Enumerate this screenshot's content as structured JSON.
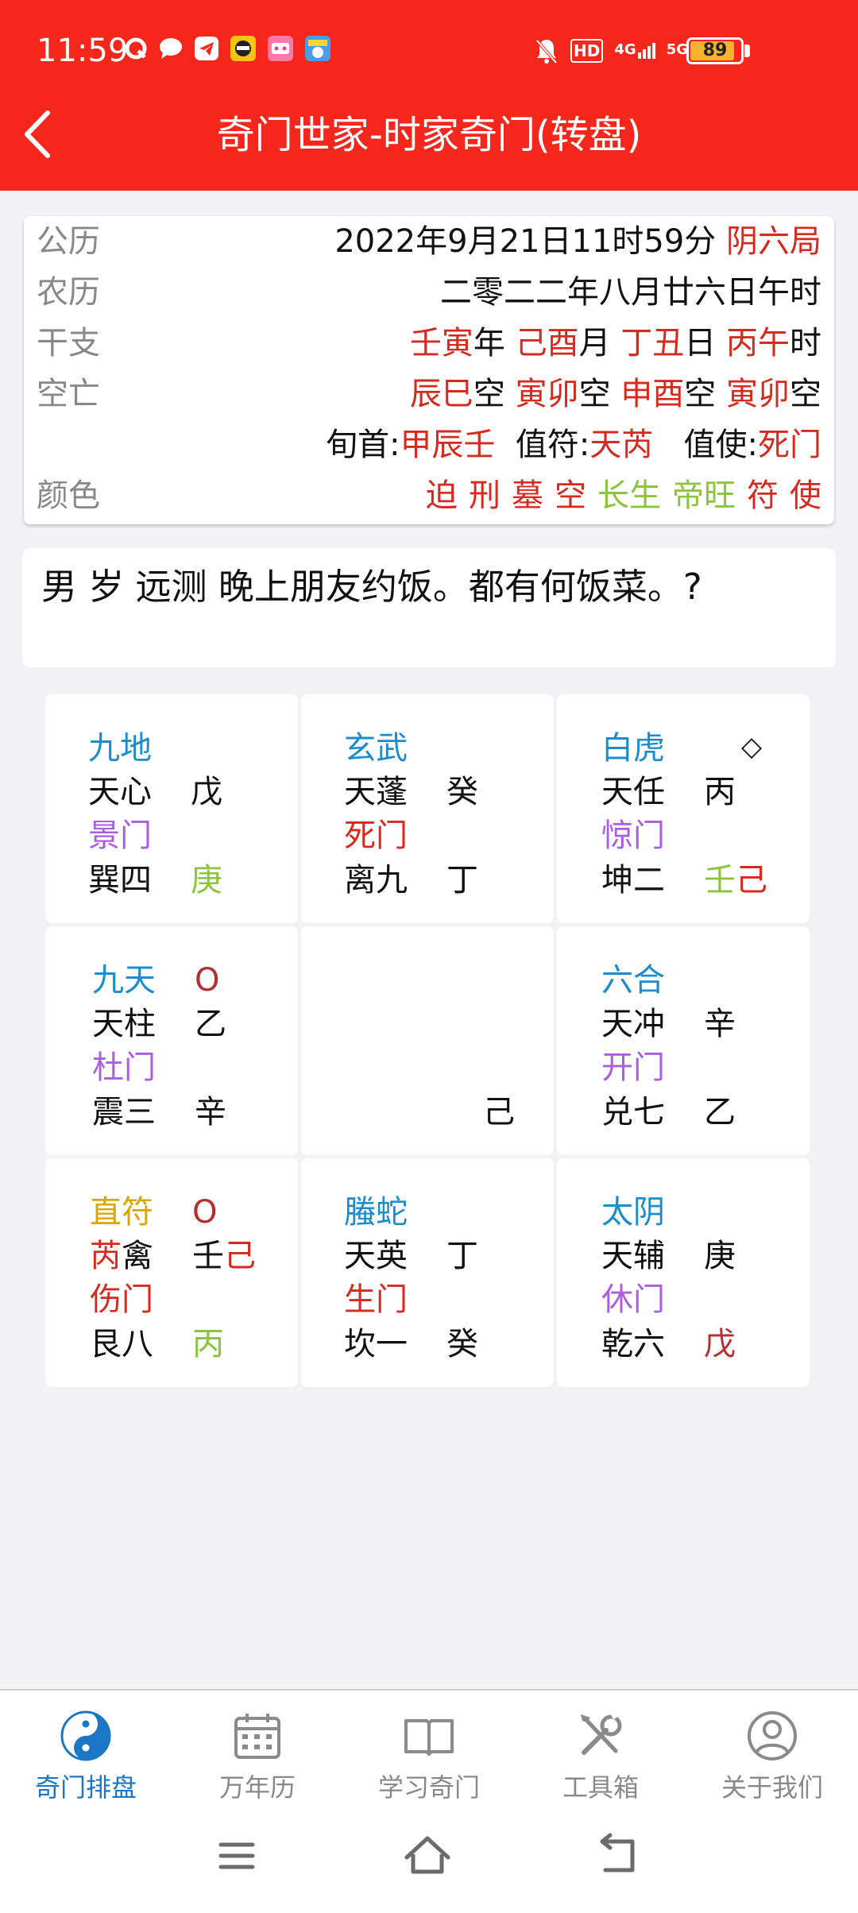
{
  "status_bar": {
    "time": "11:59",
    "notification_icons": [
      "q-icon",
      "chat-bubble-icon",
      "telegram-icon",
      "app-icon-1",
      "app-icon-2",
      "app-icon-3"
    ],
    "signal_labels": [
      "HD",
      "4G",
      "5G"
    ],
    "battery_level": "89",
    "battery_fraction": 0.89
  },
  "header": {
    "title": "奇门世家-时家奇门(转盘)"
  },
  "info": {
    "gongli": {
      "label": "公历",
      "date": "2022年9月21日11时59分",
      "ju": "阴六局"
    },
    "nongli": {
      "label": "农历",
      "value": "二零二二年八月廿六日午时"
    },
    "ganzhi": {
      "label": "干支",
      "parts": [
        {
          "gz": "壬寅",
          "unit": "年"
        },
        {
          "gz": "己酉",
          "unit": "月"
        },
        {
          "gz": "丁丑",
          "unit": "日"
        },
        {
          "gz": "丙午",
          "unit": "时"
        }
      ]
    },
    "kongwang": {
      "label": "空亡",
      "parts": [
        {
          "gz": "辰巳",
          "unit": "空"
        },
        {
          "gz": "寅卯",
          "unit": "空"
        },
        {
          "gz": "申酉",
          "unit": "空"
        },
        {
          "gz": "寅卯",
          "unit": "空"
        }
      ]
    },
    "xun": {
      "xunshou_label": "旬首:",
      "xunshou": "甲辰壬",
      "zhifu_label": "值符:",
      "zhifu": "天芮",
      "zhishi_label": "值使:",
      "zhishi": "死门"
    },
    "colors": {
      "label": "颜色",
      "items": [
        {
          "text": "迫",
          "color": "#d42a1f"
        },
        {
          "text": "刑",
          "color": "#d42a1f"
        },
        {
          "text": "墓",
          "color": "#d42a1f"
        },
        {
          "text": "空",
          "color": "#d42a1f"
        },
        {
          "text": "长生",
          "color": "#8cc43c"
        },
        {
          "text": "帝旺",
          "color": "#8cc43c"
        },
        {
          "text": "符",
          "color": "#d42a1f"
        },
        {
          "text": "使",
          "color": "#d42a1f"
        }
      ]
    }
  },
  "question": "男 岁 远测 晚上朋友约饭。都有何饭菜。?",
  "palaces": {
    "p1": {
      "god": "九地",
      "star": "天心",
      "star_stem": "戊",
      "door": "景门",
      "gua": "巽四",
      "earth_stem": "庚"
    },
    "p2": {
      "god": "玄武",
      "star": "天蓬",
      "star_stem": "癸",
      "door": "死门",
      "gua": "离九",
      "earth_stem": "丁"
    },
    "p3": {
      "god": "白虎",
      "marker": "◇",
      "star": "天任",
      "star_stem": "丙",
      "door": "惊门",
      "gua": "坤二",
      "earth_stem_a": "壬",
      "earth_stem_b": "己"
    },
    "p4": {
      "god": "九天",
      "marker": "O",
      "star": "天柱",
      "star_stem": "乙",
      "door": "杜门",
      "gua": "震三",
      "earth_stem": "辛"
    },
    "p5": {
      "earth_stem": "己"
    },
    "p6": {
      "god": "六合",
      "star": "天冲",
      "star_stem": "辛",
      "door": "开门",
      "gua": "兑七",
      "earth_stem": "乙"
    },
    "p7": {
      "god": "直符",
      "marker": "O",
      "star_a": "芮",
      "star_b": "禽",
      "star_stem_a": "壬",
      "star_stem_b": "己",
      "door": "伤门",
      "gua": "艮八",
      "earth_stem": "丙"
    },
    "p8": {
      "god": "螣蛇",
      "star": "天英",
      "star_stem": "丁",
      "door": "生门",
      "gua": "坎一",
      "earth_stem": "癸"
    },
    "p9": {
      "god": "太阴",
      "star": "天辅",
      "star_stem": "庚",
      "door": "休门",
      "gua": "乾六",
      "earth_stem": "戊"
    }
  },
  "bottom_nav": [
    {
      "label": "奇门排盘",
      "icon": "yin-yang-icon",
      "active": true
    },
    {
      "label": "万年历",
      "icon": "calendar-icon",
      "active": false
    },
    {
      "label": "学习奇门",
      "icon": "book-icon",
      "active": false
    },
    {
      "label": "工具箱",
      "icon": "tools-icon",
      "active": false
    },
    {
      "label": "关于我们",
      "icon": "user-circle-icon",
      "active": false
    }
  ],
  "system_nav": [
    "menu-icon",
    "home-icon",
    "back-icon"
  ]
}
